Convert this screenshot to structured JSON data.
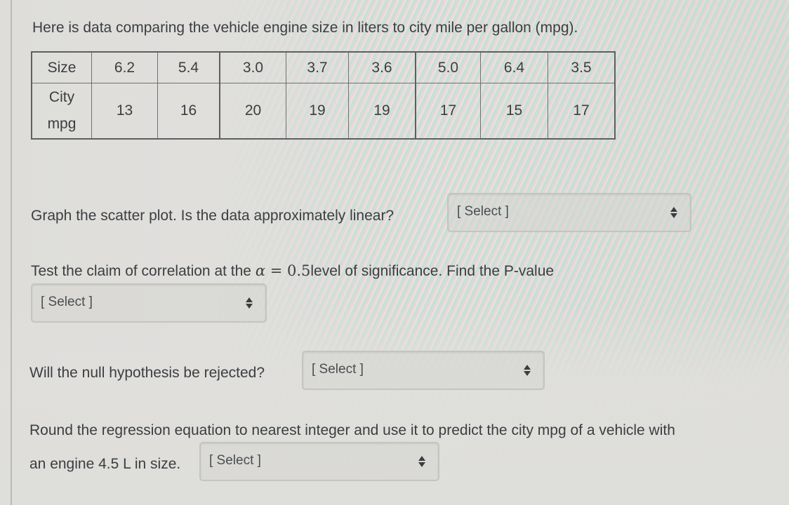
{
  "intro": "Here is data comparing the vehicle engine size in liters to city mile per gallon (mpg).",
  "table": {
    "row_headers": [
      "Size",
      "City mpg"
    ],
    "row_header_lines": {
      "city": "City",
      "mpg": "mpg"
    },
    "size": [
      "6.2",
      "5.4",
      "3.0",
      "3.7",
      "3.6",
      "5.0",
      "6.4",
      "3.5"
    ],
    "city_mpg": [
      "13",
      "16",
      "20",
      "19",
      "19",
      "17",
      "15",
      "17"
    ]
  },
  "questions": {
    "q1": {
      "text": "Graph the scatter plot.  Is the data approximately linear?",
      "select_value": "[ Select ]"
    },
    "q2": {
      "text_before": "Test the claim of correlation at the ",
      "alpha_symbol": "α",
      "equals": " = ",
      "alpha_value": "0.5",
      "text_after": "level of significance.  Find the P-value",
      "select_value": "[ Select ]"
    },
    "q3": {
      "text": "Will the null hypothesis be rejected?",
      "select_value": "[ Select ]"
    },
    "q4": {
      "line1": "Round the regression equation to nearest integer and use it to predict the city mpg of a vehicle with",
      "line2": "an engine 4.5 L in size.",
      "select_value": "[ Select ]"
    }
  },
  "icons": {
    "select_arrows": "up-down-caret-icon"
  }
}
